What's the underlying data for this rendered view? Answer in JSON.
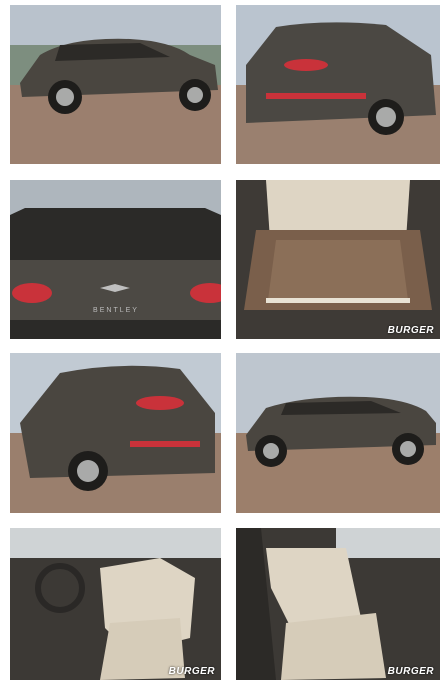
{
  "gallery": {
    "photos": [
      {
        "view": "side profile exterior, left",
        "watermark": ""
      },
      {
        "view": "rear three-quarter exterior",
        "watermark": ""
      },
      {
        "view": "rear close-up with badge",
        "watermark": ""
      },
      {
        "view": "open trunk interior",
        "watermark": "BURGER"
      },
      {
        "view": "rear three-quarter exterior, left",
        "watermark": ""
      },
      {
        "view": "side profile exterior, left, dusk",
        "watermark": ""
      },
      {
        "view": "driver seat interior",
        "watermark": "BURGER"
      },
      {
        "view": "passenger seat interior",
        "watermark": "BURGER"
      }
    ],
    "rear_badge_text": "BENTLEY"
  },
  "colors": {
    "body_paint": "#4a4640",
    "cobblestone": "#9b7f6e",
    "sky": "#b9c2cc",
    "tail_light": "#c9323a",
    "upholstery": "#ded5c4",
    "carpet": "#8b6f58"
  }
}
